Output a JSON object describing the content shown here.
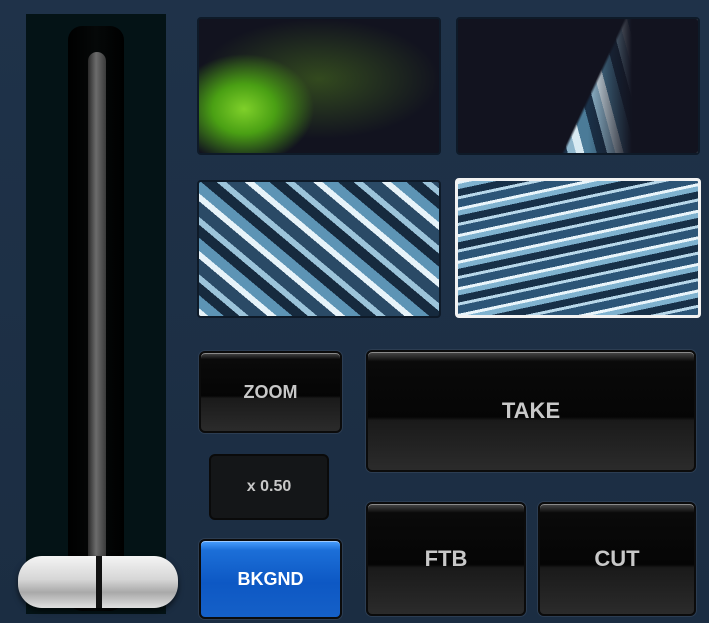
{
  "tbar": {
    "position": 0
  },
  "thumbnails": [
    {
      "name": "green-particles"
    },
    {
      "name": "crystal-blocks-right"
    },
    {
      "name": "crystal-blocks-cluster"
    },
    {
      "name": "light-streaks",
      "selected": true
    }
  ],
  "controls": {
    "zoom_label": "ZOOM",
    "zoom_value": "x 0.50",
    "bkgnd_label": "BKGND",
    "take_label": "TAKE",
    "ftb_label": "FTB",
    "cut_label": "CUT"
  },
  "colors": {
    "background": "#1d2f45",
    "bkgnd_active": "#1c6fd8",
    "button_text": "#c8c8c8"
  }
}
